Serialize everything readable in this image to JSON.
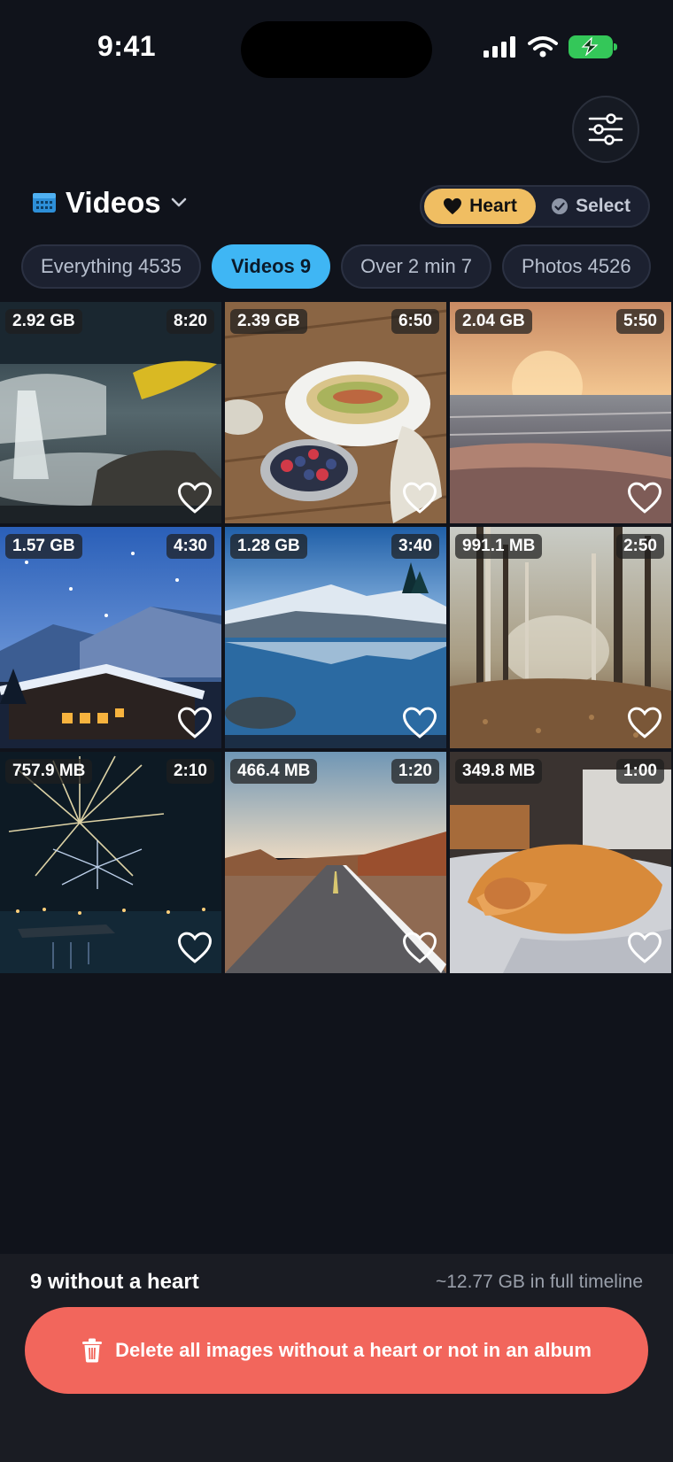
{
  "status": {
    "time": "9:41"
  },
  "header": {
    "title": "Videos",
    "segmented": {
      "heart_label": "Heart",
      "select_label": "Select"
    }
  },
  "chips": [
    {
      "label": "Everything 4535",
      "active": false
    },
    {
      "label": "Videos 9",
      "active": true
    },
    {
      "label": "Over 2 min 7",
      "active": false
    },
    {
      "label": "Photos 4526",
      "active": false
    }
  ],
  "grid": [
    {
      "size": "2.92 GB",
      "duration": "8:20",
      "subject": "waterfall"
    },
    {
      "size": "2.39 GB",
      "duration": "6:50",
      "subject": "avocado toast"
    },
    {
      "size": "2.04 GB",
      "duration": "5:50",
      "subject": "beach sunset"
    },
    {
      "size": "1.57 GB",
      "duration": "4:30",
      "subject": "snowy cabin"
    },
    {
      "size": "1.28 GB",
      "duration": "3:40",
      "subject": "mountain lake"
    },
    {
      "size": "991.1 MB",
      "duration": "2:50",
      "subject": "autumn forest"
    },
    {
      "size": "757.9 MB",
      "duration": "2:10",
      "subject": "fireworks"
    },
    {
      "size": "466.4 MB",
      "duration": "1:20",
      "subject": "desert road"
    },
    {
      "size": "349.8 MB",
      "duration": "1:00",
      "subject": "sleeping dog"
    }
  ],
  "footer": {
    "count_text": "9 without a heart",
    "full_timeline_text": "~12.77 GB in full timeline",
    "delete_label": "Delete all images without a heart or not in an album"
  },
  "colors": {
    "accent_blue": "#3fb6f4",
    "heart_gold": "#f0be62",
    "delete_red": "#f2665c",
    "battery_green": "#34c759"
  }
}
